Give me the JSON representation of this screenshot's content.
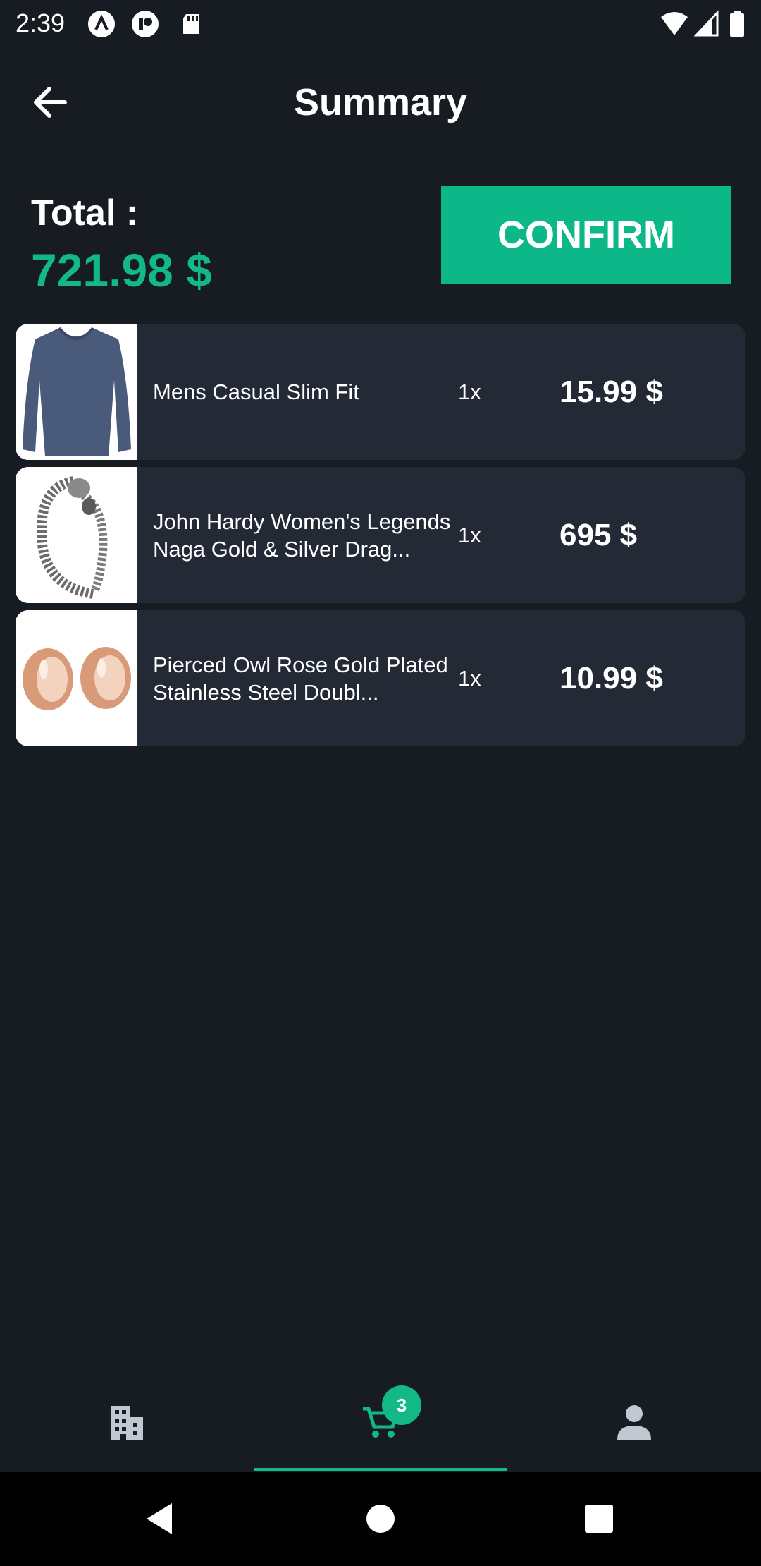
{
  "status_bar": {
    "time": "2:39",
    "left_icons": [
      "notification-a-icon",
      "notification-p-icon",
      "sd-card-icon"
    ],
    "right_icons": [
      "wifi-icon",
      "signal-icon",
      "battery-icon"
    ]
  },
  "header": {
    "title": "Summary",
    "back_icon": "arrow-left-icon"
  },
  "summary": {
    "total_label": "Total :",
    "total_value": "721.98 $",
    "confirm_label": "CONFIRM"
  },
  "items": [
    {
      "name": "Mens Casual Slim Fit",
      "quantity": "1x",
      "price": "15.99 $",
      "image": "shirt-image"
    },
    {
      "name": "John Hardy Women's Legends Naga Gold & Silver Drag...",
      "quantity": "1x",
      "price": "695 $",
      "image": "bracelet-image"
    },
    {
      "name": "Pierced Owl Rose Gold Plated Stainless Steel Doubl...",
      "quantity": "1x",
      "price": "10.99 $",
      "image": "earrings-image"
    }
  ],
  "bottom_nav": {
    "tabs": [
      {
        "name": "stores",
        "icon": "building-icon"
      },
      {
        "name": "cart",
        "icon": "cart-icon",
        "badge": "3"
      },
      {
        "name": "profile",
        "icon": "person-icon"
      }
    ],
    "active": "cart"
  },
  "colors": {
    "background": "#171b22",
    "card": "#232a36",
    "accent": "#12b886",
    "text": "#ffffff",
    "inactive_icon": "#c2c8d2"
  }
}
